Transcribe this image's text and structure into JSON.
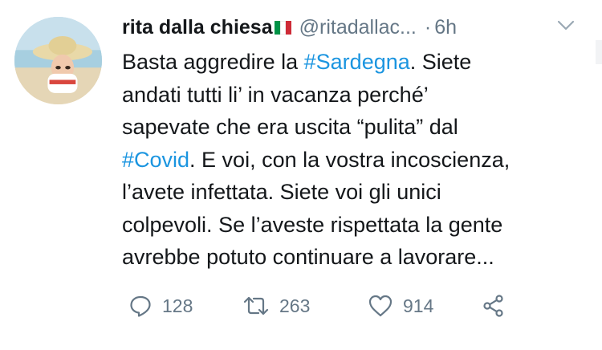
{
  "tweet": {
    "display_name": "rita dalla chiesa",
    "handle": "@ritadallac...",
    "separator": "·",
    "time": "6h",
    "lines": [
      [
        {
          "t": "Basta aggredire la "
        },
        {
          "t": "#Sardegna",
          "tag": true
        },
        {
          "t": ". Siete"
        }
      ],
      [
        {
          "t": "andati tutti li’ in vacanza perché’"
        }
      ],
      [
        {
          "t": "sapevate che era uscita “pulita” dal"
        }
      ],
      [
        {
          "t": "#Covid",
          "tag": true
        },
        {
          "t": ". E voi, con la vostra incoscienza,"
        }
      ],
      [
        {
          "t": "l’avete infettata. Siete voi gli unici"
        }
      ],
      [
        {
          "t": "colpevoli. Se l’aveste rispettata la gente"
        }
      ],
      [
        {
          "t": "avrebbe potuto continuare a lavorare..."
        }
      ]
    ]
  },
  "actions": {
    "replies": "128",
    "retweets": "263",
    "likes": "914"
  },
  "icons": {
    "avatar": "profile-photo-beach-hat",
    "flag": "italy-flag-emoji",
    "caret": "chevron-down-icon",
    "reply": "comment-bubble-icon",
    "retweet": "retweet-arrows-icon",
    "like": "heart-outline-icon",
    "share": "share-icon"
  },
  "colors": {
    "text": "#14171a",
    "muted": "#657786",
    "hashtag": "#1b95e0",
    "flag_green": "#009246",
    "flag_white": "#ffffff",
    "flag_red": "#ce2b37"
  }
}
